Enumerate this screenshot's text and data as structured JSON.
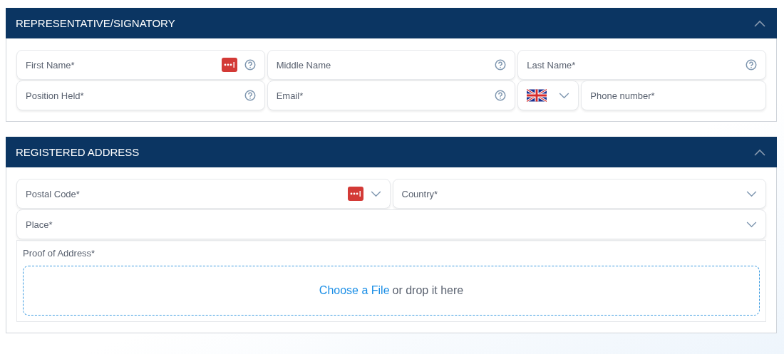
{
  "sections": [
    {
      "title": "REPRESENTATIVE/SIGNATORY",
      "expanded": true,
      "rows": [
        {
          "fields": [
            {
              "kind": "text",
              "placeholder": "First Name*",
              "autofill": true,
              "help": true,
              "dropdown": false
            },
            {
              "kind": "text",
              "placeholder": "Middle Name",
              "autofill": false,
              "help": true,
              "dropdown": false
            },
            {
              "kind": "text",
              "placeholder": "Last Name*",
              "autofill": false,
              "help": true,
              "dropdown": false
            }
          ]
        },
        {
          "fields": [
            {
              "kind": "text",
              "placeholder": "Position Held*",
              "autofill": false,
              "help": true,
              "dropdown": false
            },
            {
              "kind": "text",
              "placeholder": "Email*",
              "autofill": false,
              "help": true,
              "dropdown": false
            },
            {
              "kind": "country-code",
              "autofill": false,
              "help": false,
              "dropdown": true
            },
            {
              "kind": "text",
              "placeholder": "Phone number*",
              "autofill": false,
              "help": false,
              "dropdown": false
            }
          ]
        }
      ]
    },
    {
      "title": "REGISTERED ADDRESS",
      "expanded": true,
      "rows": [
        {
          "fields": [
            {
              "kind": "text",
              "placeholder": "Postal Code*",
              "autofill": true,
              "help": false,
              "dropdown": true
            },
            {
              "kind": "text",
              "placeholder": "Country*",
              "autofill": false,
              "help": false,
              "dropdown": true
            }
          ]
        },
        {
          "fields": [
            {
              "kind": "text",
              "placeholder": "Place*",
              "autofill": false,
              "help": false,
              "dropdown": true
            }
          ]
        }
      ],
      "upload": {
        "label": "Proof of Address*",
        "link": "Choose a File",
        "text": "or drop it here"
      }
    }
  ]
}
